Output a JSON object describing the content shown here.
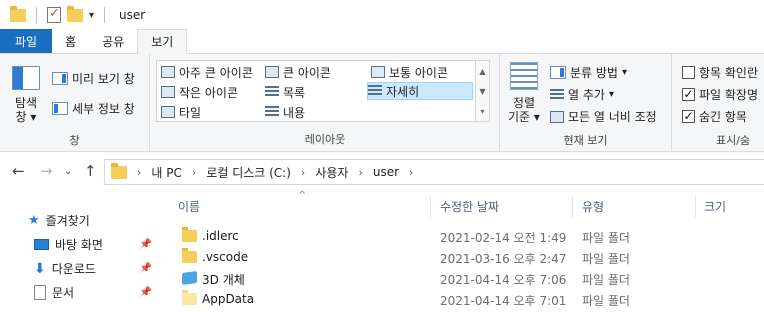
{
  "window": {
    "title": "user"
  },
  "ribbon_tabs": [
    "파일",
    "홈",
    "공유",
    "보기"
  ],
  "ribbon": {
    "pane_group": {
      "nav_pane_label_1": "탐색",
      "nav_pane_label_2": "창",
      "preview_label": "미리 보기 창",
      "details_label": "세부 정보 창",
      "group_label": "창"
    },
    "layout_group": {
      "items": [
        "아주 큰 아이콘",
        "큰 아이콘",
        "보통 아이콘",
        "작은 아이콘",
        "목록",
        "자세히",
        "타일",
        "내용"
      ],
      "selected": "자세히",
      "group_label": "레이아웃"
    },
    "view_group": {
      "sort_label_1": "정렬",
      "sort_label_2": "기준",
      "group_by": "분류 방법",
      "add_columns": "열 추가",
      "size_all_columns": "모든 열 너비 조정",
      "group_label": "현재 보기"
    },
    "showhide_group": {
      "item_checkboxes": "항목 확인란",
      "file_extensions": "파일 확장명",
      "hidden_items": "숨긴 항목",
      "group_label": "표시/숨"
    }
  },
  "address": {
    "crumbs": [
      "내 PC",
      "로컬 디스크 (C:)",
      "사용자",
      "user"
    ]
  },
  "nav": {
    "quick_access": "즐겨찾기",
    "items": [
      "바탕 화면",
      "다운로드",
      "문서"
    ]
  },
  "columns": {
    "name": "이름",
    "date": "수정한 날짜",
    "type": "유형",
    "size": "크기"
  },
  "files": [
    {
      "name": ".idlerc",
      "date": "2021-02-14 오전 1:49",
      "type": "파일 폴더"
    },
    {
      "name": ".vscode",
      "date": "2021-03-16 오후 2:47",
      "type": "파일 폴더"
    },
    {
      "name": "3D 개체",
      "date": "2021-04-14 오후 7:06",
      "type": "파일 폴더"
    },
    {
      "name": "AppData",
      "date": "2021-04-14 오후 7:01",
      "type": "파일 폴더"
    }
  ]
}
